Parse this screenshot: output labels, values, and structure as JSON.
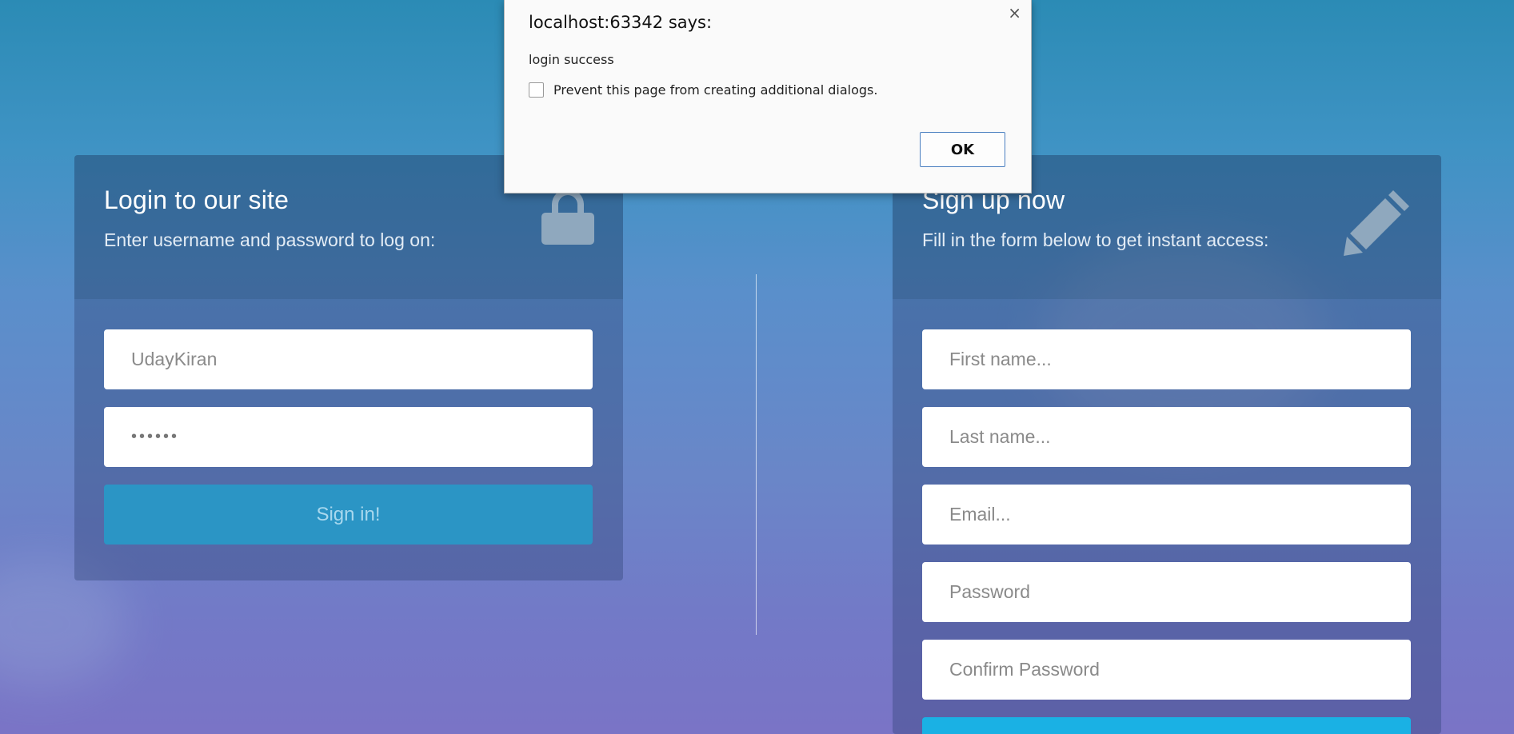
{
  "dialog": {
    "title": "localhost:63342 says:",
    "message": "login success",
    "checkbox_label": "Prevent this page from creating additional dialogs.",
    "ok_label": "OK",
    "close_glyph": "×"
  },
  "login": {
    "title": "Login to our site",
    "subtitle": "Enter username and password to log on:",
    "icon": "lock-icon",
    "username_value": "UdayKiran",
    "password_value": "••••••",
    "submit_label": "Sign in!"
  },
  "signup": {
    "title": "Sign up now",
    "subtitle": "Fill in the form below to get instant access:",
    "icon": "pencil-icon",
    "first_name_placeholder": "First name...",
    "last_name_placeholder": "Last name...",
    "email_placeholder": "Email...",
    "password_placeholder": "Password",
    "confirm_password_placeholder": "Confirm Password"
  },
  "colors": {
    "signin_button": "#2b95c5",
    "signup_button": "#1ab1e4",
    "dialog_ok_border": "#4a7fc0"
  }
}
